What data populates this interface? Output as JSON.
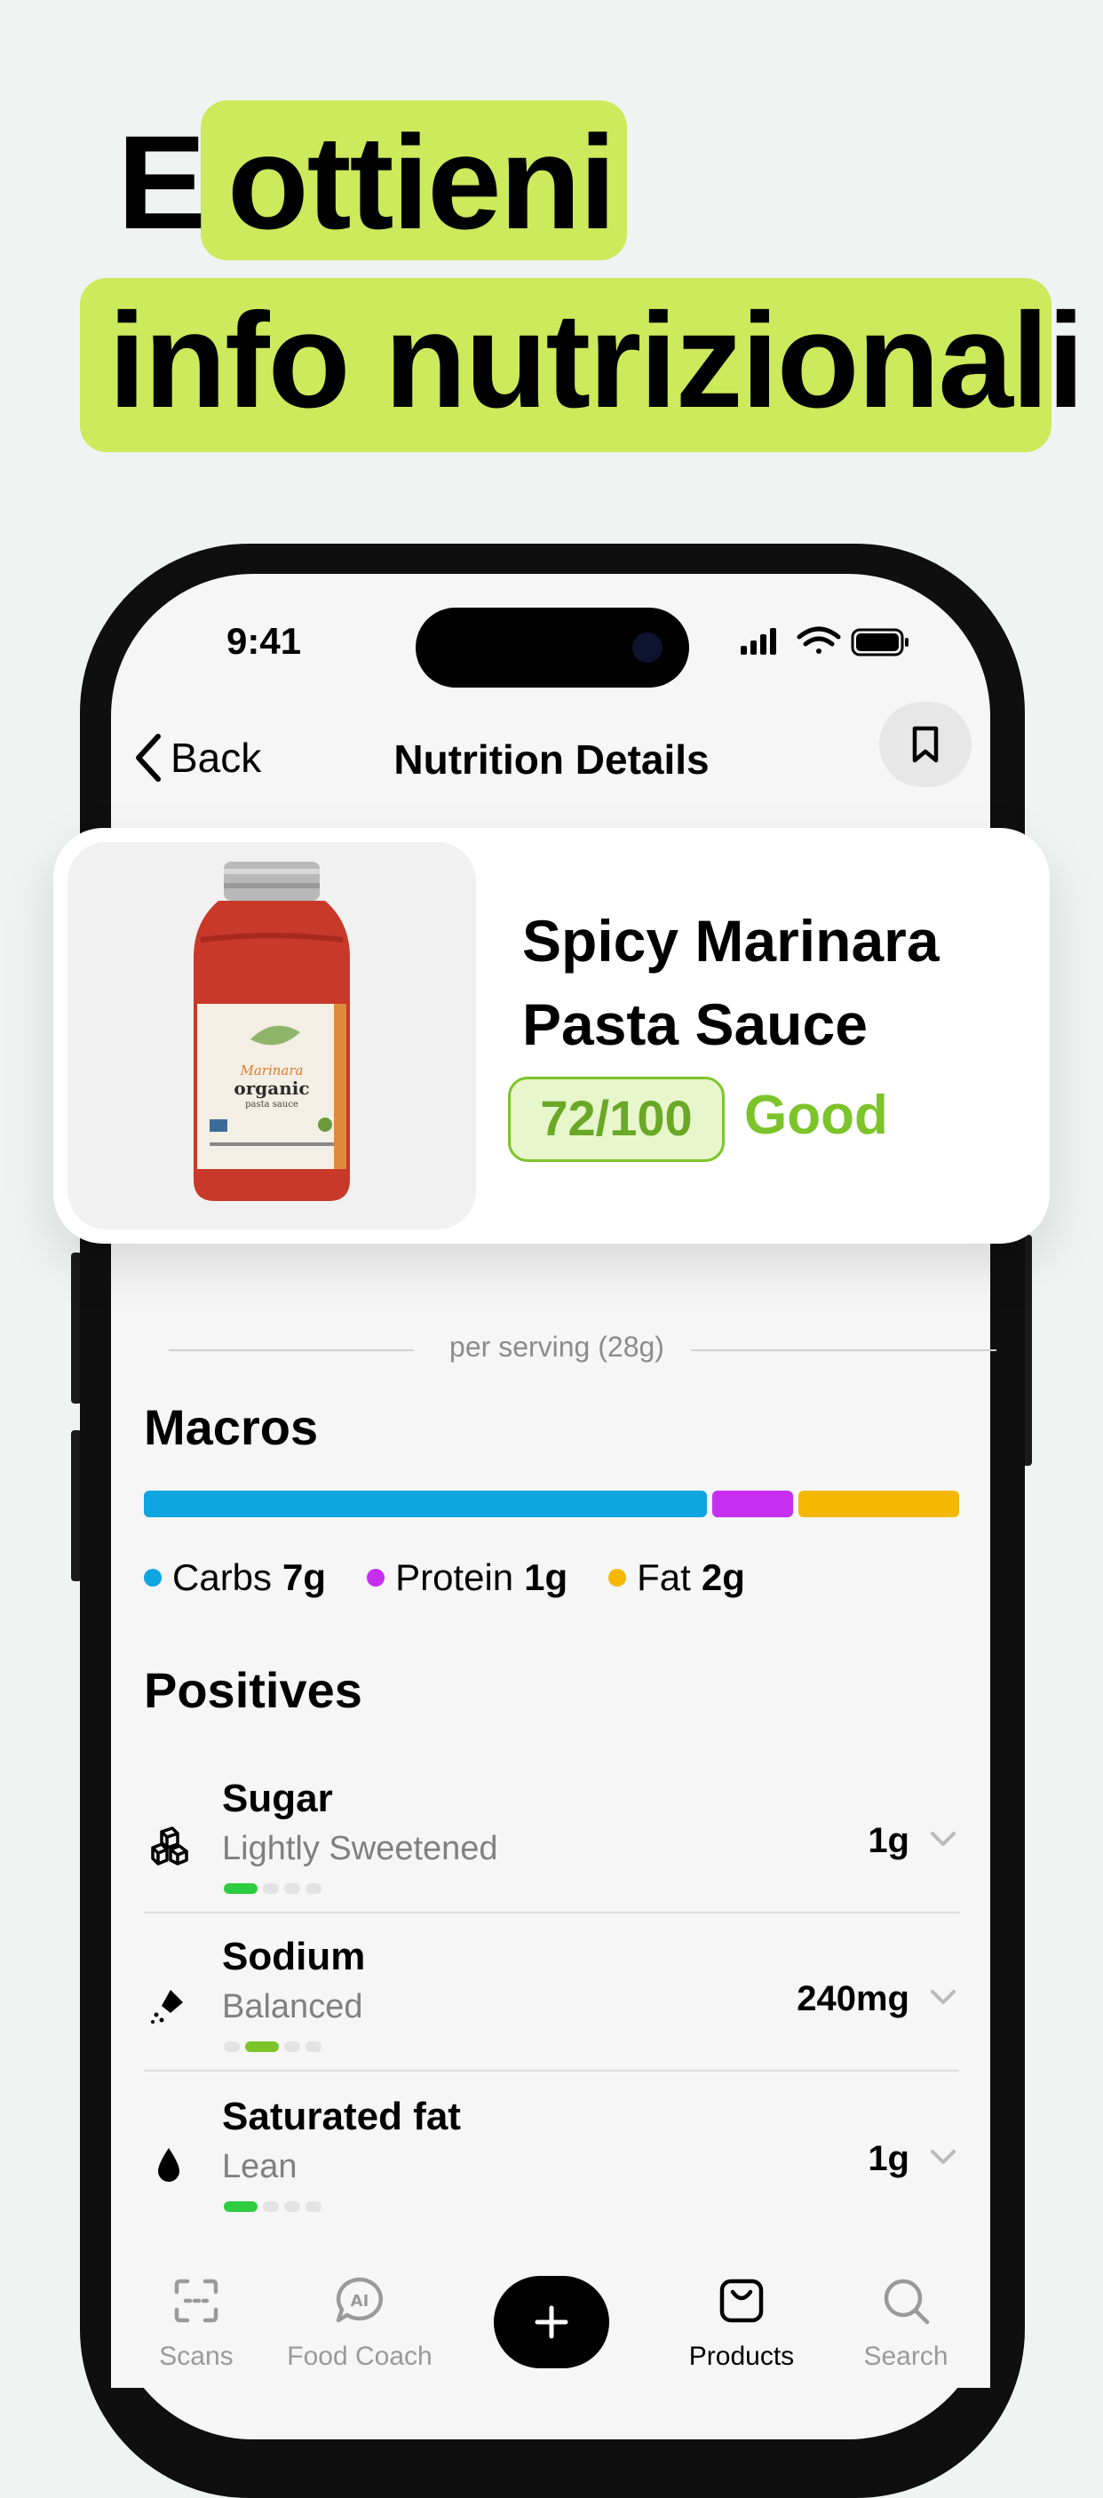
{
  "headline": {
    "line1_plain": "E",
    "line1_highlight": "ottieni",
    "line2_highlight": "info nutrizionali"
  },
  "status_bar": {
    "time": "9:41"
  },
  "nav": {
    "back_label": "Back",
    "title": "Nutrition Details",
    "bookmark_icon": "bookmark-icon"
  },
  "product": {
    "name": "Spicy Marinara Pasta Sauce",
    "score": "72/100",
    "rating": "Good",
    "jar_label": {
      "brand": "Marinara",
      "type": "organic",
      "sub": "pasta sauce"
    }
  },
  "nutrition": {
    "serving": "per serving (28g)",
    "macros_title": "Macros",
    "macros": [
      {
        "label": "Carbs",
        "value": "7g",
        "color": "#0ea5e0"
      },
      {
        "label": "Protein",
        "value": "1g",
        "color": "#c62ef0"
      },
      {
        "label": "Fat",
        "value": "2g",
        "color": "#f5b800"
      }
    ],
    "positives_title": "Positives",
    "positives": [
      {
        "name": "Sugar",
        "desc": "Lightly Sweetened",
        "value": "1g",
        "icon": "sugar-cubes-icon",
        "level": 1
      },
      {
        "name": "Sodium",
        "desc": "Balanced",
        "value": "240mg",
        "icon": "salt-shaker-icon",
        "level": 2
      },
      {
        "name": "Saturated fat",
        "desc": "Lean",
        "value": "1g",
        "icon": "drop-icon",
        "level": 1
      }
    ]
  },
  "tabbar": {
    "tabs": [
      {
        "label": "Scans",
        "icon": "scan-icon"
      },
      {
        "label": "Food Coach",
        "icon": "ai-chat-icon"
      },
      {
        "label": "Products",
        "icon": "bag-icon",
        "active": true
      },
      {
        "label": "Search",
        "icon": "search-icon"
      }
    ],
    "add_icon": "plus-icon"
  },
  "colors": {
    "accent_green": "#cde95c",
    "score_green": "#7cc42a"
  }
}
